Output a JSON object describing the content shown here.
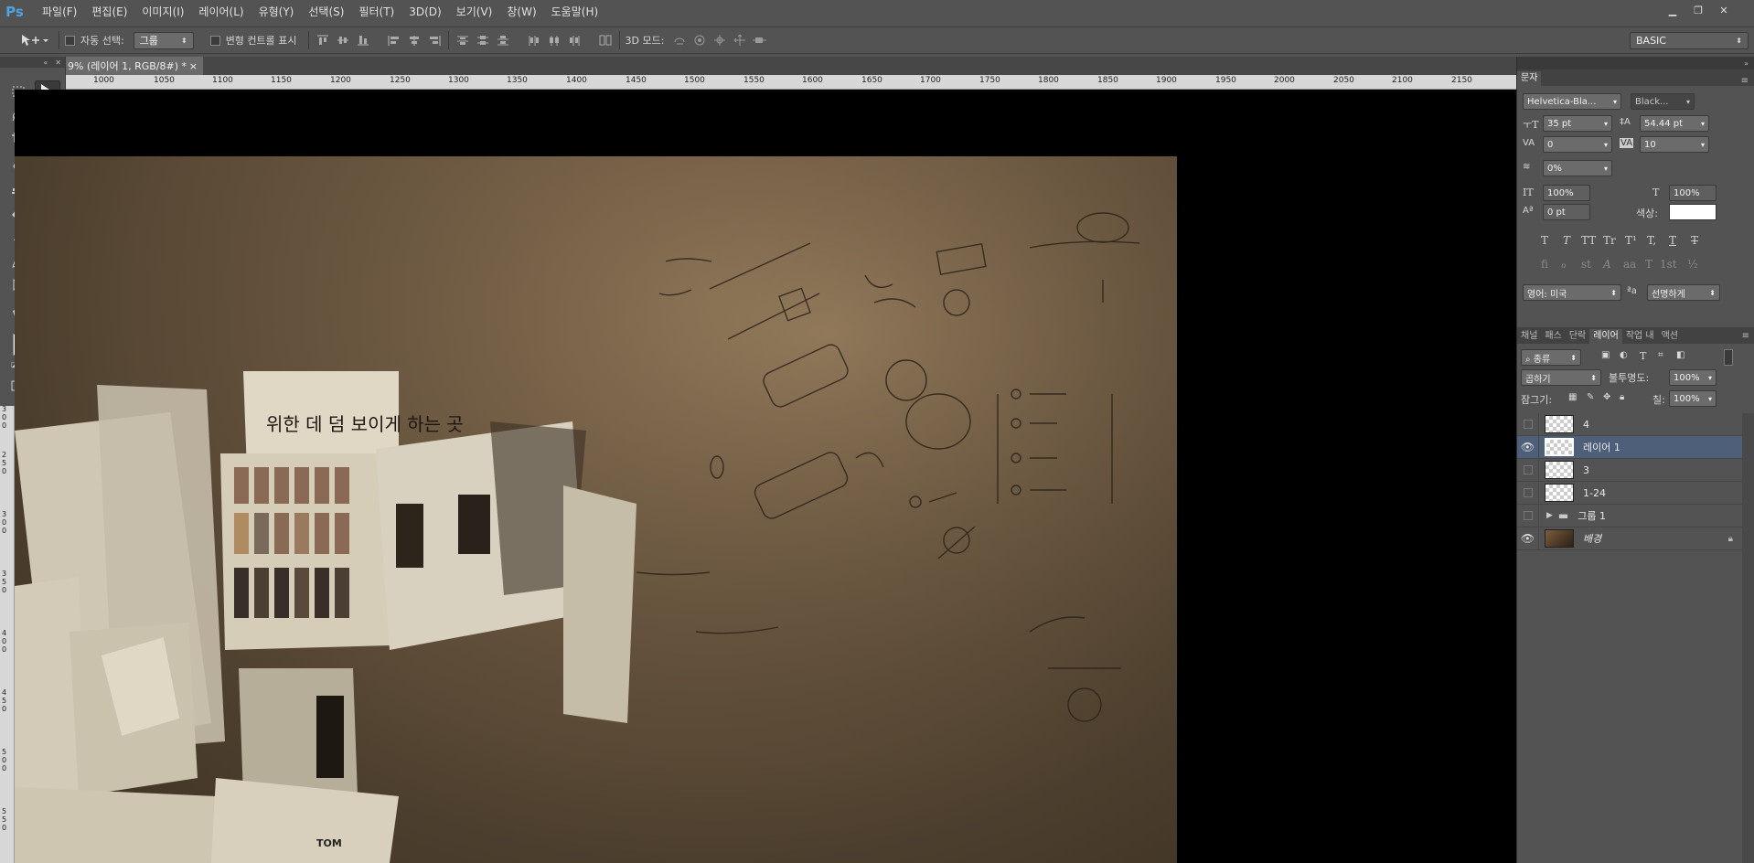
{
  "app": {
    "logo": "Ps"
  },
  "menu": [
    "파일(F)",
    "편집(E)",
    "이미지(I)",
    "레이어(L)",
    "유형(Y)",
    "선택(S)",
    "필터(T)",
    "3D(D)",
    "보기(V)",
    "창(W)",
    "도움말(H)"
  ],
  "options": {
    "auto_select_label": "자동 선택:",
    "auto_select_value": "그룹",
    "transform_label": "변형 컨트롤 표시",
    "mode_3d_label": "3D 모드:",
    "workspace": "BASIC"
  },
  "document": {
    "tab_title": "9% (레이어 1, RGB/8#) *",
    "close": "×",
    "ruler_ticks": [
      "1000",
      "1050",
      "1100",
      "1150",
      "1200",
      "1250",
      "1300",
      "1350",
      "1400",
      "1450",
      "1500",
      "1550",
      "1600",
      "1650",
      "1700",
      "1750",
      "1800",
      "1850",
      "1900",
      "1950",
      "2000",
      "2050",
      "2100",
      "2150"
    ],
    "ruler_left": [
      "3",
      "0",
      "0",
      "2",
      "5",
      "0",
      "3",
      "0",
      "0",
      "3",
      "5",
      "0",
      "4",
      "0",
      "0",
      "4",
      "5",
      "0",
      "5",
      "0",
      "0",
      "5",
      "5",
      "0"
    ]
  },
  "character": {
    "tab": "문자",
    "font_family": "Helvetica-Bla...",
    "font_style": "Black...",
    "size": "35 pt",
    "leading": "54.44 pt",
    "kerning": "0",
    "tracking": "10",
    "tsume": "0%",
    "vscale": "100%",
    "hscale": "100%",
    "baseline": "0 pt",
    "color_label": "색상:",
    "color": "#ffffff",
    "style_buttons": [
      "T",
      "T",
      "TT",
      "Tr",
      "T¹",
      "T,",
      "T",
      "T"
    ],
    "opentype_buttons": [
      "fi",
      "ℴ",
      "st",
      "A",
      "aa",
      "T",
      "1st",
      "½"
    ],
    "language": "영어: 미국",
    "aa_label": "ªa",
    "antialias": "선명하게"
  },
  "layers_panel": {
    "tabs": [
      "채널",
      "패스",
      "단락",
      "레이어",
      "작업 내",
      "액션"
    ],
    "active_tab": "레이어",
    "filter": "종류",
    "blend_mode": "곱하기",
    "opacity_label": "불투명도:",
    "opacity": "100%",
    "lock_label": "잠그기:",
    "fill_label": "칠:",
    "fill": "100%",
    "layers": [
      {
        "name": "4",
        "visible": false,
        "selected": false,
        "type": "smart"
      },
      {
        "name": "레이어 1",
        "visible": true,
        "selected": true,
        "type": "pixel"
      },
      {
        "name": "3",
        "visible": false,
        "selected": false,
        "type": "smart"
      },
      {
        "name": "1-24",
        "visible": false,
        "selected": false,
        "type": "smart"
      },
      {
        "name": "그룹 1",
        "visible": false,
        "selected": false,
        "type": "group"
      },
      {
        "name": "배경",
        "visible": true,
        "selected": false,
        "type": "background"
      }
    ]
  },
  "canvas": {
    "photo_texts": [
      "위한 데 덤 보이게 하는 곳",
      "TOM"
    ]
  }
}
